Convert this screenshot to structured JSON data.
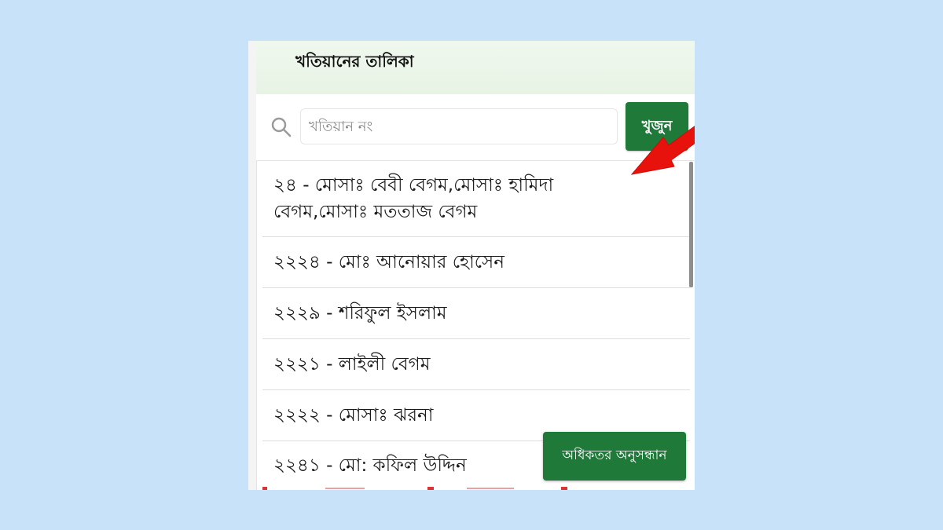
{
  "header": {
    "title": "খতিয়ানের তালিকা"
  },
  "search": {
    "placeholder": "খতিয়ান নং",
    "button_label": "খুজুন",
    "icon": "search-icon"
  },
  "list": {
    "items": [
      {
        "label": "২৪ - মোসাঃ বেবী বেগম,মোসাঃ হামিদা বেগম,মোসাঃ মততাজ বেগম"
      },
      {
        "label": "২২২৪ - মোঃ আনোয়ার হোসেন"
      },
      {
        "label": "২২২৯ - শরিফুল ইসলাম"
      },
      {
        "label": "২২২১ - লাইলী বেগম"
      },
      {
        "label": "২২২২ - মোসাঃ ঝরনা"
      },
      {
        "label": "২২৪১ - মো: কফিল উদ্দিন"
      }
    ]
  },
  "more_button": {
    "label": "অধিকতর অনুসন্ধান"
  },
  "annotation": {
    "icon": "arrow-icon",
    "color": "#e8120c"
  },
  "colors": {
    "accent": "#1f7a3a",
    "background": "#c8e3f9",
    "header_bg": "#eaf5e8"
  }
}
